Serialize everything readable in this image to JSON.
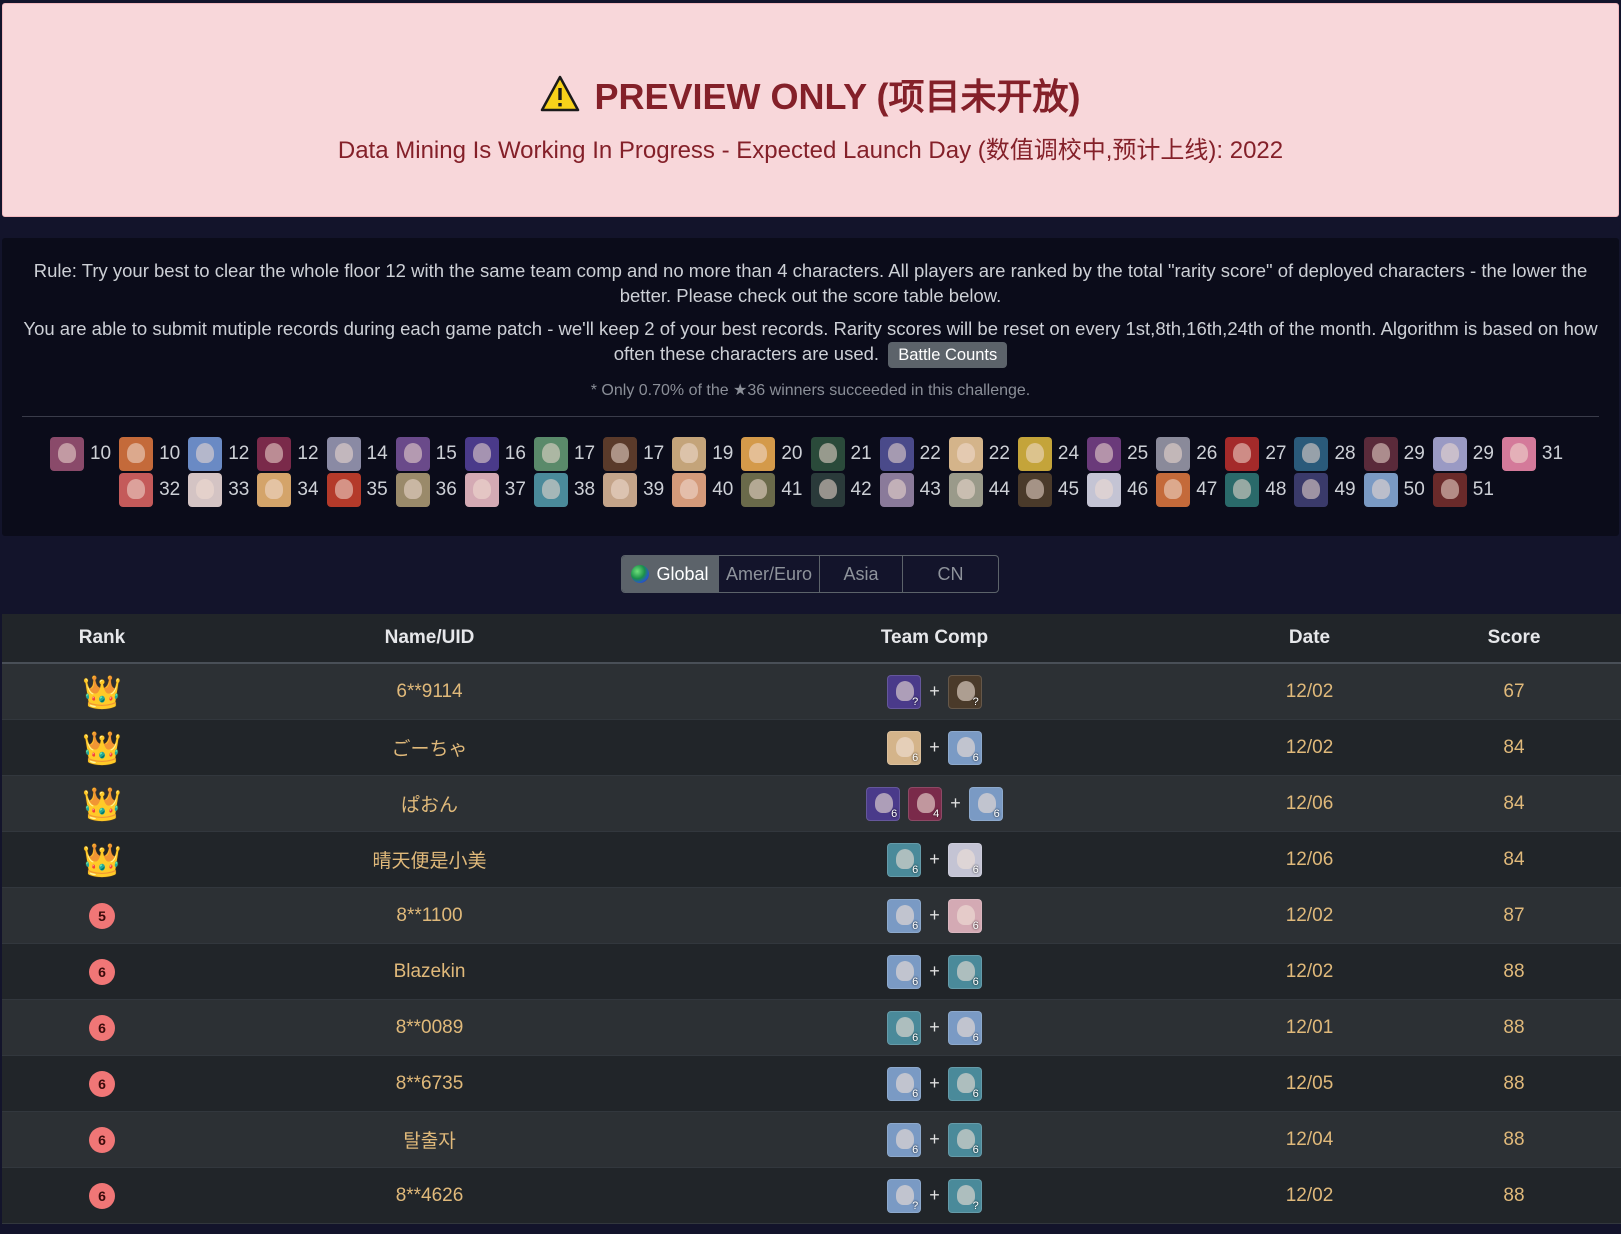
{
  "alert": {
    "title": "PREVIEW ONLY (项目未开放)",
    "subtitle": "Data Mining Is Working In Progress - Expected Launch Day (数值调校中,预计上线): 2022"
  },
  "info": {
    "rule_line1": "Rule: Try your best to clear the whole floor 12 with the same team comp and no more than 4 characters. All players are ranked by the total \"rarity score\" of deployed characters - the lower the better. Please check out the score table below.",
    "rule_line2": "You are able to submit mutiple records during each game patch - we'll keep 2 of your best records. Rarity scores will be reset on every 1st,8th,16th,24th of the month. Algorithm is based on how often these characters are used.",
    "battle_counts_label": "Battle Counts",
    "note": "* Only 0.70% of the ★36 winners succeeded in this challenge."
  },
  "characters": [
    {
      "score": "10",
      "color": "#8a4a6a"
    },
    {
      "score": "10",
      "color": "#c46a3a"
    },
    {
      "score": "12",
      "color": "#6a8ac4"
    },
    {
      "score": "12",
      "color": "#7a2a4a"
    },
    {
      "score": "14",
      "color": "#8a8aa4"
    },
    {
      "score": "15",
      "color": "#6a4a8a"
    },
    {
      "score": "16",
      "color": "#4a3a8a"
    },
    {
      "score": "17",
      "color": "#5a8a6a"
    },
    {
      "score": "17",
      "color": "#5a3a2a"
    },
    {
      "score": "19",
      "color": "#c4a47a"
    },
    {
      "score": "20",
      "color": "#d49a4a"
    },
    {
      "score": "21",
      "color": "#2a4a3a"
    },
    {
      "score": "22",
      "color": "#4a4a8a"
    },
    {
      "score": "22",
      "color": "#d4b48a"
    },
    {
      "score": "24",
      "color": "#c4a43a"
    },
    {
      "score": "25",
      "color": "#6a3a7a"
    },
    {
      "score": "26",
      "color": "#8a8a9a"
    },
    {
      "score": "27",
      "color": "#a42a2a"
    },
    {
      "score": "28",
      "color": "#2a5a7a"
    },
    {
      "score": "29",
      "color": "#5a2a3a"
    },
    {
      "score": "29",
      "color": "#9a9ac4"
    },
    {
      "score": "31",
      "color": "#d47a9a"
    },
    {
      "score": "32",
      "color": "#c45a5a"
    },
    {
      "score": "33",
      "color": "#d4c4c4"
    },
    {
      "score": "34",
      "color": "#d4a46a"
    },
    {
      "score": "35",
      "color": "#b43a2a"
    },
    {
      "score": "36",
      "color": "#9a8a6a"
    },
    {
      "score": "37",
      "color": "#d4aab4"
    },
    {
      "score": "38",
      "color": "#4a8a9a"
    },
    {
      "score": "39",
      "color": "#c4a48a"
    },
    {
      "score": "40",
      "color": "#d49a7a"
    },
    {
      "score": "41",
      "color": "#6a6a4a"
    },
    {
      "score": "42",
      "color": "#2a3a3a"
    },
    {
      "score": "43",
      "color": "#8a7a9a"
    },
    {
      "score": "44",
      "color": "#9a9a8a"
    },
    {
      "score": "45",
      "color": "#4a3a2a"
    },
    {
      "score": "46",
      "color": "#c4c4d4"
    },
    {
      "score": "47",
      "color": "#c46a3a"
    },
    {
      "score": "48",
      "color": "#2a6a6a"
    },
    {
      "score": "49",
      "color": "#3a3a6a"
    },
    {
      "score": "50",
      "color": "#7a9ac4"
    },
    {
      "score": "51",
      "color": "#6a2a2a"
    }
  ],
  "region_tabs": {
    "global": "Global",
    "amer_euro": "Amer/Euro",
    "asia": "Asia",
    "cn": "CN"
  },
  "table": {
    "headers": {
      "rank": "Rank",
      "name": "Name/UID",
      "team": "Team Comp",
      "date": "Date",
      "score": "Score"
    },
    "rows": [
      {
        "rank": "crown-1",
        "name": "6**9114",
        "team": [
          {
            "c": "?",
            "color": "#4a3a8a"
          },
          {
            "c": "?",
            "color": "#4a3a2a"
          }
        ],
        "date": "12/02",
        "score": "67"
      },
      {
        "rank": "crown",
        "name": "ごーちゃ",
        "team": [
          {
            "c": "6",
            "color": "#d4b48a"
          },
          {
            "c": "6",
            "color": "#7a9ac4"
          }
        ],
        "date": "12/02",
        "score": "84"
      },
      {
        "rank": "crown",
        "name": "ぱおん",
        "team": [
          {
            "c": "6",
            "color": "#4a3a8a"
          },
          {
            "c": "4",
            "color": "#7a2a4a"
          },
          {
            "c": "6",
            "color": "#7a9ac4"
          }
        ],
        "date": "12/06",
        "score": "84"
      },
      {
        "rank": "crown",
        "name": "晴天便是小美",
        "team": [
          {
            "c": "6",
            "color": "#4a8a9a"
          },
          {
            "c": "6",
            "color": "#c4c4d4"
          }
        ],
        "date": "12/06",
        "score": "84"
      },
      {
        "rank": "5",
        "name": "8**1100",
        "team": [
          {
            "c": "6",
            "color": "#7a9ac4"
          },
          {
            "c": "6",
            "color": "#d4aab4"
          }
        ],
        "date": "12/02",
        "score": "87"
      },
      {
        "rank": "6",
        "name": "Blazekin",
        "team": [
          {
            "c": "6",
            "color": "#7a9ac4"
          },
          {
            "c": "6",
            "color": "#4a8a9a"
          }
        ],
        "date": "12/02",
        "score": "88"
      },
      {
        "rank": "6",
        "name": "8**0089",
        "team": [
          {
            "c": "6",
            "color": "#4a8a9a"
          },
          {
            "c": "6",
            "color": "#7a9ac4"
          }
        ],
        "date": "12/01",
        "score": "88"
      },
      {
        "rank": "6",
        "name": "8**6735",
        "team": [
          {
            "c": "6",
            "color": "#7a9ac4"
          },
          {
            "c": "6",
            "color": "#4a8a9a"
          }
        ],
        "date": "12/05",
        "score": "88"
      },
      {
        "rank": "6",
        "name": "탈출자",
        "team": [
          {
            "c": "6",
            "color": "#7a9ac4"
          },
          {
            "c": "6",
            "color": "#4a8a9a"
          }
        ],
        "date": "12/04",
        "score": "88"
      },
      {
        "rank": "6",
        "name": "8**4626",
        "team": [
          {
            "c": "?",
            "color": "#7a9ac4"
          },
          {
            "c": "?",
            "color": "#4a8a9a"
          }
        ],
        "date": "12/02",
        "score": "88"
      }
    ]
  },
  "colors": {
    "alert_bg": "#f8d7da",
    "alert_text": "#842029",
    "page_bg": "#13142b",
    "row_text": "#e0b97a",
    "rank_badge": "#f07676"
  }
}
